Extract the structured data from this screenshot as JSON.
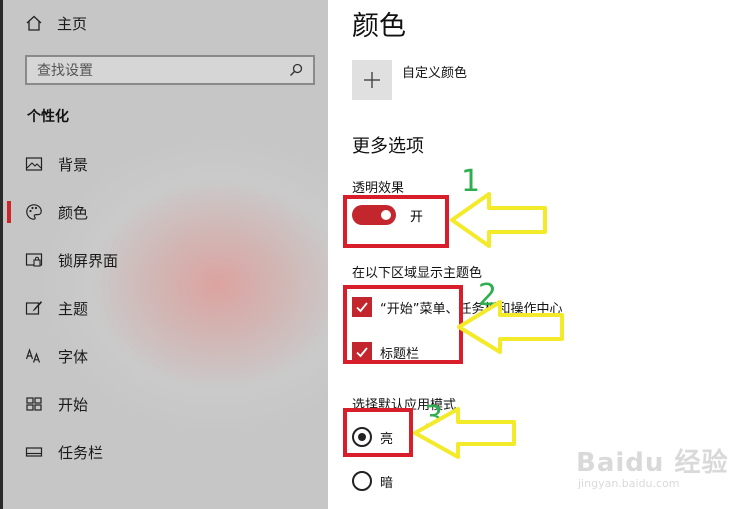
{
  "sidebar": {
    "home": "主页",
    "search_placeholder": "查找设置",
    "section_title": "个性化",
    "items": [
      {
        "label": "背景",
        "icon": "picture-icon"
      },
      {
        "label": "颜色",
        "icon": "palette-icon",
        "active": true
      },
      {
        "label": "锁屏界面",
        "icon": "lock-screen-icon"
      },
      {
        "label": "主题",
        "icon": "theme-brush-icon"
      },
      {
        "label": "字体",
        "icon": "font-icon"
      },
      {
        "label": "开始",
        "icon": "start-grid-icon"
      },
      {
        "label": "任务栏",
        "icon": "taskbar-icon"
      }
    ]
  },
  "main": {
    "title": "颜色",
    "custom_color_label": "自定义颜色",
    "more_options_title": "更多选项",
    "transparency": {
      "label": "透明效果",
      "state_label": "开",
      "on": true
    },
    "accent_surfaces": {
      "label": "在以下区域显示主题色",
      "start_taskbar_label": "“开始”菜单、任务栏和操作中心",
      "title_bars_label": "标题栏"
    },
    "app_mode": {
      "label": "选择默认应用模式",
      "light_label": "亮",
      "dark_label": "暗",
      "selected": "light"
    }
  },
  "annotations": {
    "n1": "1",
    "n2": "2",
    "n3": "3"
  },
  "watermark": {
    "brand": "Baidu 经验",
    "url": "jingyan.baidu.com"
  },
  "colors": {
    "accent": "#c4262e",
    "annotation_box": "#d81e2a",
    "annotation_arrow": "#f3ea2a",
    "annotation_number": "#2fae4f"
  }
}
